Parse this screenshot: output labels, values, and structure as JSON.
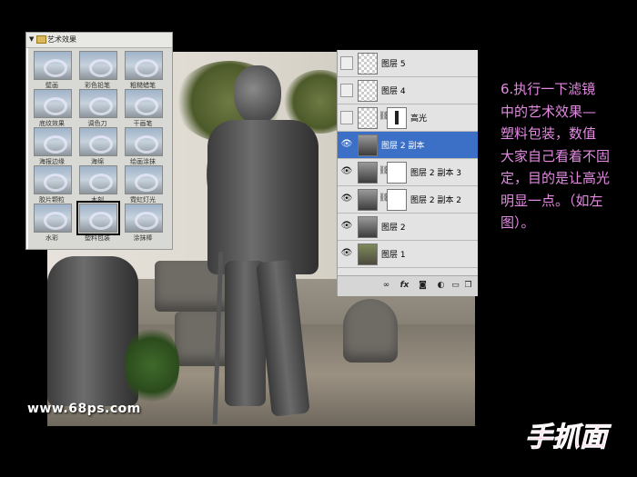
{
  "filter_gallery": {
    "category": "艺术效果",
    "items": [
      {
        "label": "壁画"
      },
      {
        "label": "彩色铅笔"
      },
      {
        "label": "粗糙蜡笔"
      },
      {
        "label": "底纹效果"
      },
      {
        "label": "调色刀"
      },
      {
        "label": "干画笔"
      },
      {
        "label": "海报边缘"
      },
      {
        "label": "海绵"
      },
      {
        "label": "绘画涂抹"
      },
      {
        "label": "胶片颗粒"
      },
      {
        "label": "木刻"
      },
      {
        "label": "霓虹灯光"
      },
      {
        "label": "水彩"
      },
      {
        "label": "塑料包装"
      },
      {
        "label": "涂抹棒"
      }
    ],
    "selected": "塑料包装"
  },
  "layers": [
    {
      "name": "图层 5",
      "visible": false,
      "thumb": "transparent",
      "mask": false,
      "active": false
    },
    {
      "name": "图层 4",
      "visible": false,
      "thumb": "transparent",
      "mask": false,
      "active": false
    },
    {
      "name": "高光",
      "visible": false,
      "thumb": "transparent",
      "mask": true,
      "active": false
    },
    {
      "name": "图层 2 副本",
      "visible": true,
      "thumb": "statue",
      "mask": false,
      "active": true
    },
    {
      "name": "图层 2 副本 3",
      "visible": true,
      "thumb": "statue",
      "mask": true,
      "active": false
    },
    {
      "name": "图层 2 副本 2",
      "visible": true,
      "thumb": "statue",
      "mask": true,
      "active": false
    },
    {
      "name": "图层 2",
      "visible": true,
      "thumb": "statue",
      "mask": false,
      "active": false
    },
    {
      "name": "图层 1",
      "visible": true,
      "thumb": "photo",
      "mask": false,
      "active": false
    }
  ],
  "layer_footer_icons": [
    "link-icon",
    "fx-icon",
    "mask-icon",
    "adjustment-icon",
    "folder-icon",
    "new-layer-icon"
  ],
  "instructions": {
    "lines": [
      "6.执行一下滤镜",
      "中的艺术效果—",
      "塑料包装，数值",
      "大家自己看着不固",
      "定，目的是让高光",
      "明显一点。（如左",
      "图）。"
    ]
  },
  "watermark": "www.68ps.com",
  "logo": "手抓面",
  "colors": {
    "instruction_text": "#e48ae2",
    "active_layer": "#3c6fc6",
    "logo": "#ff4fb5"
  }
}
